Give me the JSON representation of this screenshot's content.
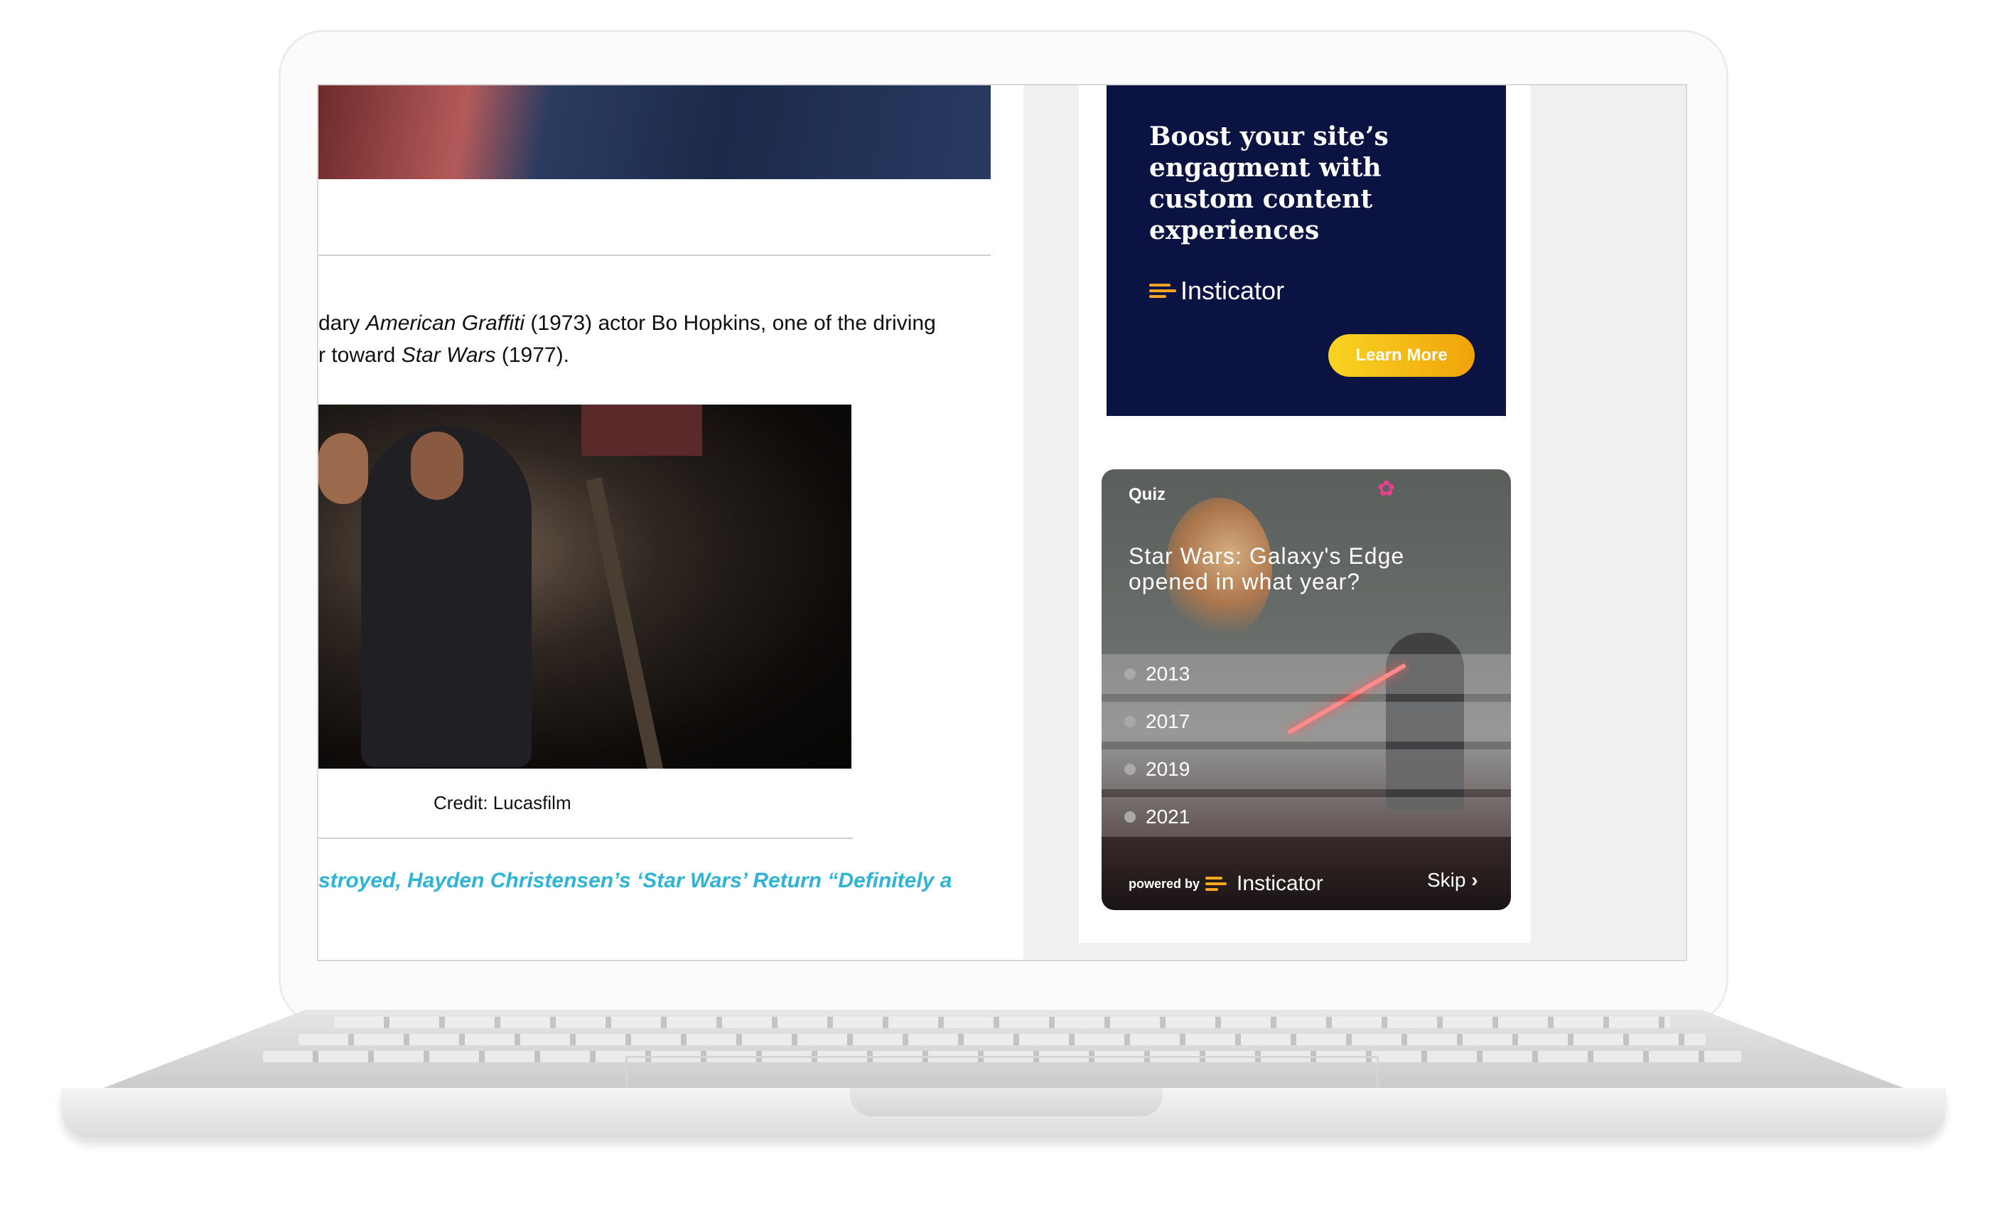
{
  "article": {
    "paragraph_line1_a": "dary ",
    "paragraph_line1_italic": "American Graffiti",
    "paragraph_line1_b": " (1973) actor Bo Hopkins, one of the driving",
    "paragraph_line2_a": "r toward ",
    "paragraph_line2_italic": "Star Wars",
    "paragraph_line2_b": " (1977).",
    "caption": "Credit: Lucasfilm",
    "related_link": "stroyed, Hayden Christensen’s ‘Star Wars’ Return “Definitely a"
  },
  "ad": {
    "headline_lines": [
      "Boost your site’s",
      "engagment with",
      "custom content",
      "experiences"
    ],
    "brand": "Insticator",
    "button_label": "Learn More"
  },
  "quiz": {
    "tag": "Quiz",
    "question": "Star Wars: Galaxy's Edge opened in what year?",
    "options": [
      "2013",
      "2017",
      "2019",
      "2021"
    ],
    "powered_by": "powered by",
    "brand": "Insticator",
    "skip_label": "Skip",
    "skip_icon": "chevron-right-icon"
  },
  "colors": {
    "ad_background": "#0a1342",
    "accent_orange": "#f5a623",
    "link_blue": "#2fb4d6"
  }
}
